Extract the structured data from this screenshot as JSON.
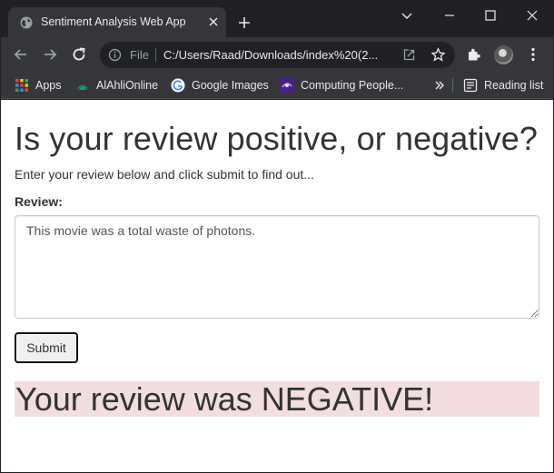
{
  "browser": {
    "tab": {
      "title": "Sentiment Analysis Web App"
    },
    "omnibox": {
      "scheme_label": "File",
      "url": "C:/Users/Raad/Downloads/index%20(2..."
    },
    "bookmarks": [
      {
        "label": "Apps",
        "icon": "apps-grid-icon"
      },
      {
        "label": "AlAhliOnline",
        "icon": "alahli-logo-icon"
      },
      {
        "label": "Google Images",
        "icon": "google-icon"
      },
      {
        "label": "Computing People...",
        "icon": "computing-people-icon"
      }
    ],
    "reading_list": {
      "label": "Reading list",
      "icon": "reading-list-icon"
    },
    "colors": {
      "chrome_dark": "#202124",
      "chrome_toolbar": "#35363a",
      "text": "#e8eaed"
    }
  },
  "page": {
    "heading": "Is your review positive, or negative?",
    "instructions": "Enter your review below and click submit to find out...",
    "review_label": "Review:",
    "review_value": "This movie was a total waste of photons.",
    "submit_label": "Submit",
    "result_text": "Your review was NEGATIVE!",
    "colors": {
      "result_background": "#f2dede",
      "text": "#333333"
    }
  }
}
